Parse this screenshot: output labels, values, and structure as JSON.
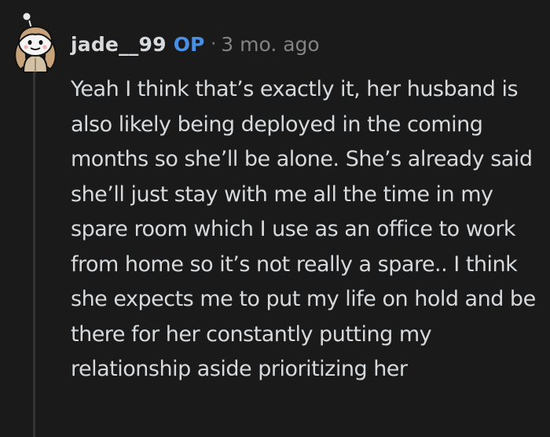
{
  "comment": {
    "author": "jade__99",
    "op_badge": "OP",
    "separator": "·",
    "timestamp": "3 mo. ago",
    "avatar_icon": "snoo-avatar-icon",
    "body": "Yeah I think that’s exactly it, her husband is also likely being deployed in the coming months so she’ll be alone. She’s already said she’ll just stay with me all the time in my spare room which I use as an office to work from home so it’s not really a spare.. I think she expects me to put my life on hold and be there for her constantly putting my relationship aside prioritizing her"
  },
  "colors": {
    "background": "#1a1a1b",
    "text": "#d7dadc",
    "meta": "#818384",
    "op": "#4a90e2",
    "thread_line": "#343536"
  }
}
